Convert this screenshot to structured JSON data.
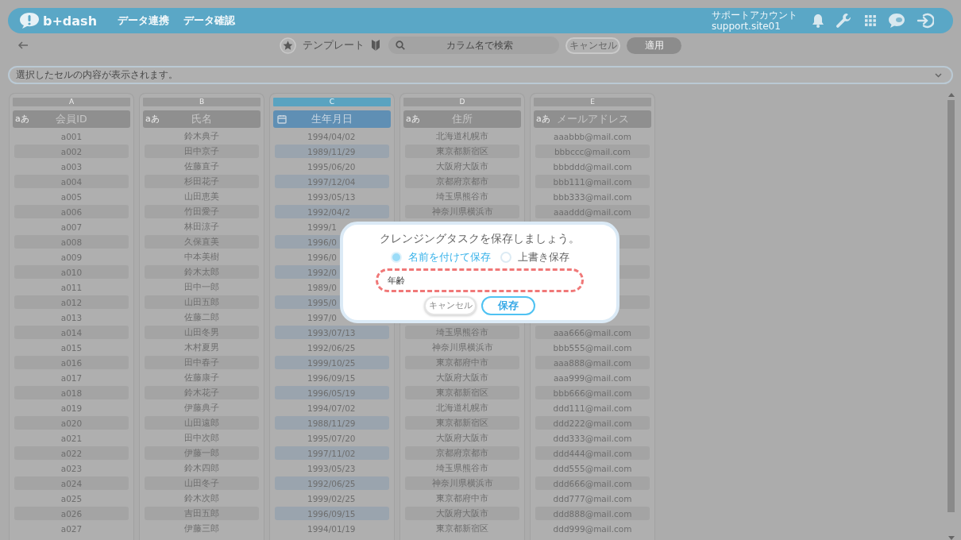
{
  "header": {
    "logo": "b+dash",
    "nav": [
      {
        "label": "データ連携"
      },
      {
        "label": "データ確認"
      }
    ],
    "account": {
      "name": "サポートアカウント",
      "id": "support.site01"
    }
  },
  "toolbar": {
    "title": "テンプレート",
    "search": {
      "placeholder": "カラム名で検索"
    },
    "buttons": [
      {
        "label": "キャンセル",
        "disabled": false
      },
      {
        "label": "適用",
        "disabled": true
      }
    ]
  },
  "info_bar": {
    "text": "選択したセルの内容が表示されます。"
  },
  "table": {
    "columns": [
      {
        "letter": "A",
        "name": "会員ID",
        "kind": "text",
        "type_label": "aあ",
        "selected": false
      },
      {
        "letter": "B",
        "name": "氏名",
        "kind": "text",
        "type_label": "aあ",
        "selected": false
      },
      {
        "letter": "C",
        "name": "生年月日",
        "kind": "date",
        "selected": true
      },
      {
        "letter": "D",
        "name": "住所",
        "kind": "text",
        "type_label": "aあ",
        "selected": false
      },
      {
        "letter": "E",
        "name": "メールアドレス",
        "kind": "text",
        "type_label": "aあ",
        "selected": false
      }
    ],
    "rows": [
      {
        "cells": [
          "a001",
          "鈴木典子",
          "1994/04/02",
          "北海道札幌市",
          "aaabbb@mail.com"
        ]
      },
      {
        "cells": [
          "a002",
          "田中京子",
          "1989/11/29",
          "東京都新宿区",
          "bbbccc@mail.com"
        ]
      },
      {
        "cells": [
          "a003",
          "佐藤直子",
          "1995/06/20",
          "大阪府大阪市",
          "bbbddd@mail.com"
        ]
      },
      {
        "cells": [
          "a004",
          "杉田花子",
          "1997/12/04",
          "京都府京都市",
          "bbb111@mail.com"
        ]
      },
      {
        "cells": [
          "a005",
          "山田恵美",
          "1993/05/13",
          "埼玉県熊谷市",
          "bbb333@mail.com"
        ]
      },
      {
        "cells": [
          "a006",
          "竹田愛子",
          "1992/04/2",
          "神奈川県横浜市",
          "aaaddd@mail.com"
        ]
      },
      {
        "cells": [
          "a007",
          "林田涼子",
          "1999/1"
        ]
      },
      {
        "cells": [
          "a008",
          "久保直美",
          "1996/0"
        ]
      },
      {
        "cells": [
          "a009",
          "中本美樹",
          "1996/0"
        ]
      },
      {
        "cells": [
          "a010",
          "鈴木太郎",
          "1992/0"
        ]
      },
      {
        "cells": [
          "a011",
          "田中一郎",
          "1989/0"
        ]
      },
      {
        "cells": [
          "a012",
          "山田五郎",
          "1995/0"
        ]
      },
      {
        "cells": [
          "a013",
          "佐藤二郎",
          "1997/0"
        ]
      },
      {
        "cells": [
          "a014",
          "山田冬男",
          "1993/07/13",
          "埼玉県熊谷市",
          "aaa666@mail.com"
        ]
      },
      {
        "cells": [
          "a015",
          "木村夏男",
          "1992/06/25",
          "神奈川県横浜市",
          "bbb555@mail.com"
        ]
      },
      {
        "cells": [
          "a016",
          "田中春子",
          "1999/10/25",
          "東京都府中市",
          "aaa888@mail.com"
        ]
      },
      {
        "cells": [
          "a017",
          "佐藤康子",
          "1996/09/15",
          "大阪府大阪市",
          "aaa999@mail.com"
        ]
      },
      {
        "cells": [
          "a018",
          "鈴木花子",
          "1996/05/19",
          "東京都新宿区",
          "bbb666@mail.com"
        ]
      },
      {
        "cells": [
          "a019",
          "伊藤典子",
          "1994/07/02",
          "北海道札幌市",
          "ddd111@mail.com"
        ]
      },
      {
        "cells": [
          "a020",
          "山田遠郎",
          "1988/11/29",
          "東京都新宿区",
          "ddd222@mail.com"
        ]
      },
      {
        "cells": [
          "a021",
          "田中次郎",
          "1995/07/20",
          "大阪府大阪市",
          "ddd333@mail.com"
        ]
      },
      {
        "cells": [
          "a022",
          "伊藤一郎",
          "1997/11/02",
          "京都府京都市",
          "ddd444@mail.com"
        ]
      },
      {
        "cells": [
          "a023",
          "鈴木四郎",
          "1993/05/23",
          "埼玉県熊谷市",
          "ddd555@mail.com"
        ]
      },
      {
        "cells": [
          "a024",
          "山田冬子",
          "1992/06/25",
          "神奈川県横浜市",
          "ddd666@mail.com"
        ]
      },
      {
        "cells": [
          "a025",
          "鈴木次郎",
          "1999/02/25",
          "東京都府中市",
          "ddd777@mail.com"
        ]
      },
      {
        "cells": [
          "a026",
          "吉田五郎",
          "1996/09/15",
          "大阪府大阪市",
          "ddd888@mail.com"
        ]
      },
      {
        "cells": [
          "a027",
          "伊藤三郎",
          "1994/01/19",
          "東京都新宿区",
          "ddd999@mail.com"
        ]
      }
    ]
  },
  "dialog": {
    "title": "クレンジングタスクを保存しましょう。",
    "options": [
      {
        "label": "名前を付けて保存",
        "selected": true
      },
      {
        "label": "上書き保存",
        "selected": false
      }
    ],
    "name_field": {
      "value": "年齢",
      "highlighted": true
    },
    "buttons": [
      {
        "label": "キャンセル",
        "kind": "secondary"
      },
      {
        "label": "保存",
        "kind": "primary"
      }
    ]
  }
}
